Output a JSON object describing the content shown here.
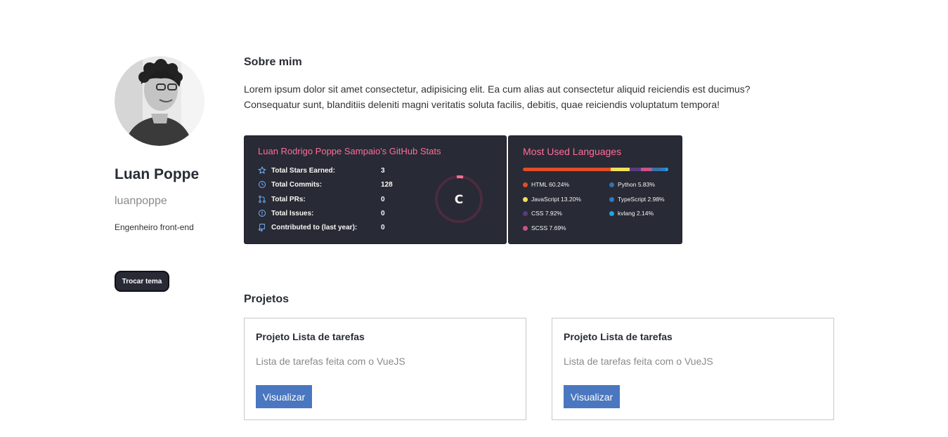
{
  "profile": {
    "name": "Luan Poppe",
    "username": "luanpoppe",
    "role": "Engenheiro front-end",
    "theme_button": "Trocar tema"
  },
  "about": {
    "title": "Sobre mim",
    "line1": "Lorem ipsum dolor sit amet consectetur, adipisicing elit. Ea cum alias aut consectetur aliquid reiciendis est ducimus?",
    "line2": "Consequatur sunt, blanditiis deleniti magni veritatis soluta facilis, debitis, quae reiciendis voluptatum tempora!"
  },
  "github_stats": {
    "title": "Luan Rodrigo Poppe Sampaio's GitHub Stats",
    "rank": "C",
    "rows": [
      {
        "icon": "star-icon",
        "label": "Total Stars Earned:",
        "value": "3"
      },
      {
        "icon": "history-icon",
        "label": "Total Commits:",
        "value": "128"
      },
      {
        "icon": "pull-request-icon",
        "label": "Total PRs:",
        "value": "0"
      },
      {
        "icon": "issue-icon",
        "label": "Total Issues:",
        "value": "0"
      },
      {
        "icon": "repo-icon",
        "label": "Contributed to (last year):",
        "value": "0"
      }
    ]
  },
  "languages": {
    "title": "Most Used Languages",
    "items": [
      {
        "label": "HTML 60.24%",
        "percent": 60.24,
        "color": "#e34c26"
      },
      {
        "label": "JavaScript 13.20%",
        "percent": 13.2,
        "color": "#f1e05a"
      },
      {
        "label": "CSS 7.92%",
        "percent": 7.92,
        "color": "#563d7c"
      },
      {
        "label": "SCSS 7.69%",
        "percent": 7.69,
        "color": "#c6538c"
      },
      {
        "label": "Python 5.83%",
        "percent": 5.83,
        "color": "#3572a5"
      },
      {
        "label": "TypeScript 2.98%",
        "percent": 2.98,
        "color": "#3178c6"
      },
      {
        "label": "kvlang 2.14%",
        "percent": 2.14,
        "color": "#1da6e0"
      }
    ]
  },
  "projects": {
    "title": "Projetos",
    "items": [
      {
        "title": "Projeto Lista de tarefas",
        "description": "Lista de tarefas feita com o VueJS",
        "button": "Visualizar"
      },
      {
        "title": "Projeto Lista de tarefas",
        "description": "Lista de tarefas feita com o VueJS",
        "button": "Visualizar"
      }
    ]
  },
  "colors": {
    "card_bg": "#282a36",
    "title_pink": "#ff6e96",
    "button_blue": "#4a77c0"
  }
}
